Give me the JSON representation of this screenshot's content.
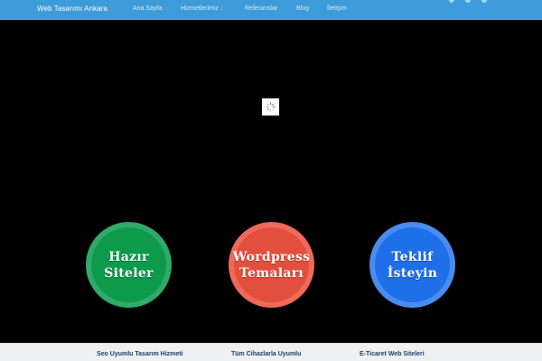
{
  "navbar": {
    "brand": "Web Tasarımı Ankara",
    "items": [
      "Ana Sayfa",
      "Hizmetlerimiz ↓",
      "Referanslar",
      "Blog",
      "İletişim"
    ]
  },
  "hero": {
    "circles": [
      {
        "line1": "Hazır",
        "line2": "Siteler",
        "color": "#0e9a4d"
      },
      {
        "line1": "Wordpress",
        "line2": "Temaları",
        "color": "#e34f3d"
      },
      {
        "line1": "Teklif",
        "line2": "İsteyin",
        "color": "#1f6fe8"
      }
    ]
  },
  "features": [
    "Seo Uyumlu Tasarım Hizmeti",
    "Tüm Cihazlarla Uyumlu",
    "E-Ticaret Web Siteleri"
  ],
  "colors": {
    "nav_bg": "#3d9bd9",
    "hero_bg": "#000000",
    "footer_bg": "#eef0f2"
  }
}
